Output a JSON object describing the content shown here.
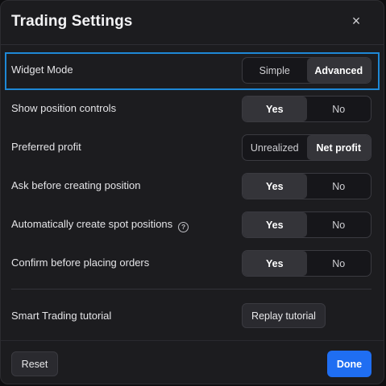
{
  "dialog": {
    "title": "Trading Settings",
    "close_label": "×"
  },
  "settings": [
    {
      "label": "Widget Mode",
      "options": [
        "Simple",
        "Advanced"
      ],
      "selected": "Advanced"
    },
    {
      "label": "Show position controls",
      "options": [
        "Yes",
        "No"
      ],
      "selected": "Yes"
    },
    {
      "label": "Preferred profit",
      "options": [
        "Unrealized",
        "Net profit"
      ],
      "selected": "Net profit"
    },
    {
      "label": "Ask before creating position",
      "options": [
        "Yes",
        "No"
      ],
      "selected": "Yes"
    },
    {
      "label": "Automatically create spot positions",
      "info_icon": "?",
      "options": [
        "Yes",
        "No"
      ],
      "selected": "Yes"
    },
    {
      "label": "Confirm before placing orders",
      "options": [
        "Yes",
        "No"
      ],
      "selected": "Yes"
    }
  ],
  "tutorial": {
    "label": "Smart Trading tutorial",
    "button": "Replay tutorial"
  },
  "footer": {
    "reset": "Reset",
    "done": "Done"
  },
  "colors": {
    "accent": "#1f6ef2",
    "highlight": "#1e88d6"
  }
}
